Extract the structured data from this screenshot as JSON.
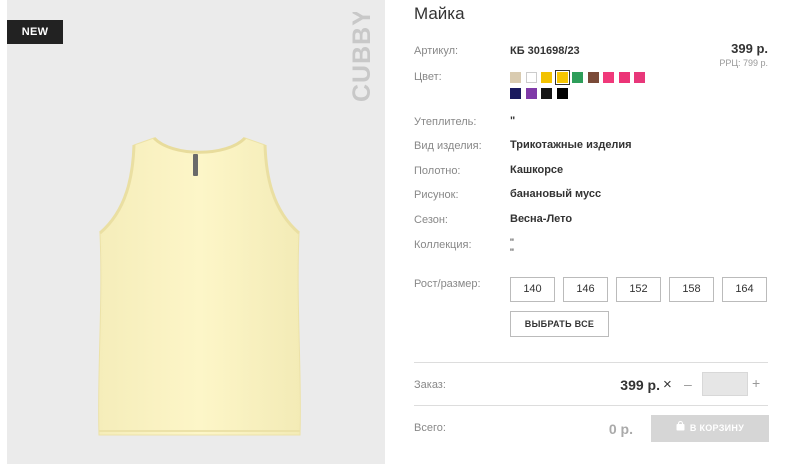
{
  "product": {
    "badge": "NEW",
    "brand": "CUBBY",
    "title": "Майка"
  },
  "specs": {
    "article_label": "Артикул:",
    "article_value": "КБ 301698/23",
    "color_label": "Цвет:",
    "insulation_label": "Утеплитель:",
    "insulation_value": "\"",
    "type_label": "Вид изделия:",
    "type_value": "Трикотажные изделия",
    "fabric_label": "Полотно:",
    "fabric_value": "Кашкорсе",
    "pattern_label": "Рисунок:",
    "pattern_value": "банановый мусс",
    "season_label": "Сезон:",
    "season_value": "Весна-Лето",
    "collection_label": "Коллекция:",
    "collection_value": "\"\n\"",
    "size_label": "Рост/размер:"
  },
  "price": {
    "value": "399 р.",
    "rrp": "РРЦ: 799 р."
  },
  "colors": [
    {
      "name": "beige",
      "hex": "#d9cbb0"
    },
    {
      "name": "white",
      "hex": "#ffffff"
    },
    {
      "name": "yellow",
      "hex": "#f2c200"
    },
    {
      "name": "yellow-selected",
      "hex": "#f7c600",
      "selected": true
    },
    {
      "name": "green",
      "hex": "#2e9e5a"
    },
    {
      "name": "brown",
      "hex": "#7a4a38"
    },
    {
      "name": "pink-1",
      "hex": "#f0397a"
    },
    {
      "name": "pink-2",
      "hex": "#ec3477"
    },
    {
      "name": "pink-3",
      "hex": "#e8377a"
    },
    {
      "name": "navy",
      "hex": "#1a1a5e"
    },
    {
      "name": "purple",
      "hex": "#7f3aa8"
    },
    {
      "name": "black-1",
      "hex": "#151515"
    },
    {
      "name": "black-2",
      "hex": "#000000"
    }
  ],
  "sizes": [
    "140",
    "146",
    "152",
    "158",
    "164"
  ],
  "select_all": "ВЫБРАТЬ ВСЕ",
  "order": {
    "label": "Заказ:",
    "price": "399 р.",
    "times": "×",
    "minus": "–",
    "plus": "+",
    "quantity": ""
  },
  "total": {
    "label": "Всего:",
    "value": "0 р."
  },
  "cart_button": "В КОРЗИНУ",
  "garment_color": "#fdf6c6"
}
